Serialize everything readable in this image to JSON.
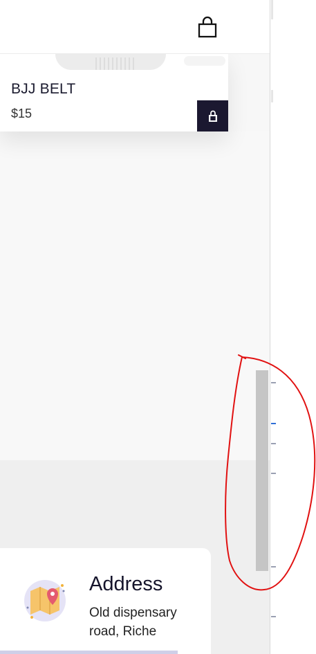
{
  "header": {
    "cart_icon": "shopping-bag-icon"
  },
  "product": {
    "name": "BJJ BELT",
    "price": "$15",
    "add_icon": "shopping-bag-icon"
  },
  "address": {
    "title": "Address",
    "text": "Old dispensary road, Riche",
    "icon": "map-pin-icon"
  },
  "colors": {
    "accent_dark": "#1b1830",
    "annotation_red": "#e11111"
  }
}
